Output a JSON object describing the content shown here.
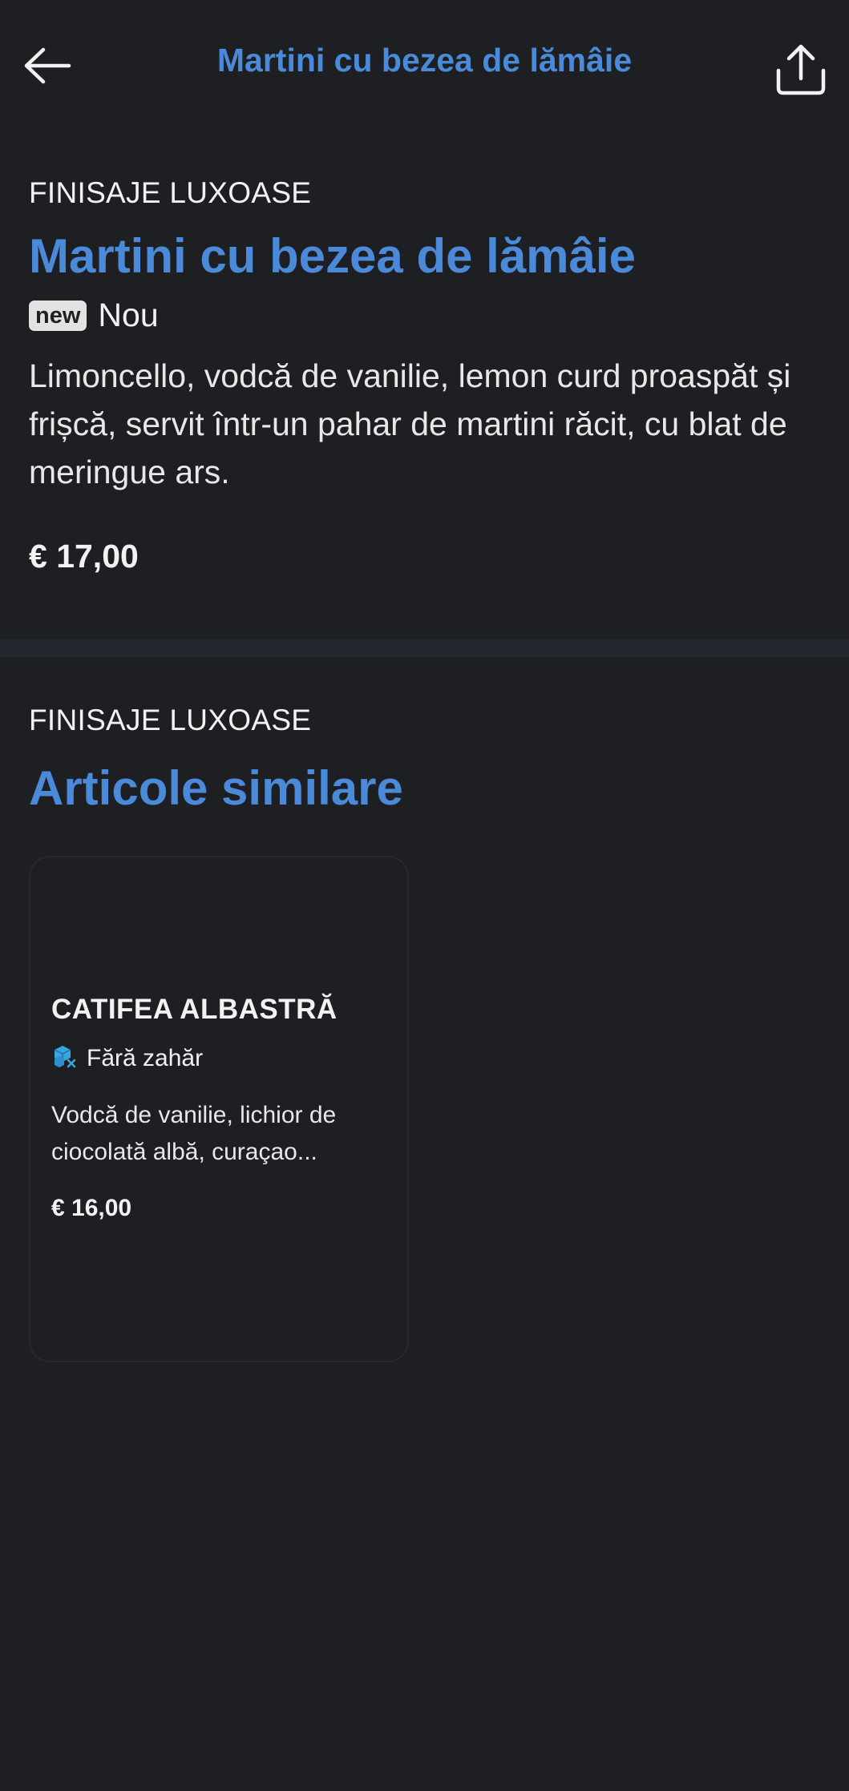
{
  "header": {
    "title": "Martini cu bezea de lămâie",
    "back_icon": "arrow-left-icon",
    "share_icon": "share-icon"
  },
  "item": {
    "category": "FINISAJE LUXOASE",
    "title": "Martini cu bezea de lămâie",
    "badge": "new",
    "badge_label": "Nou",
    "description": "Limoncello, vodcă de vanilie, lemon curd proaspăt și frișcă, servit într-un pahar de martini răcit, cu blat de meringue ars.",
    "price": "€ 17,00"
  },
  "similar": {
    "category": "FINISAJE LUXOASE",
    "title": "Articole similare",
    "cards": [
      {
        "title": "CATIFEA ALBASTRĂ",
        "tag_icon": "sugar-free-icon",
        "tag": "Fără zahăr",
        "description": "Vodcă de vanilie, lichior de ciocolată albă, curaçao...",
        "price": "€ 16,00"
      }
    ]
  },
  "colors": {
    "background": "#1e1f22",
    "accent": "#4a8ad8",
    "divider": "#23272f",
    "badge_bg": "#e2e2e2"
  }
}
